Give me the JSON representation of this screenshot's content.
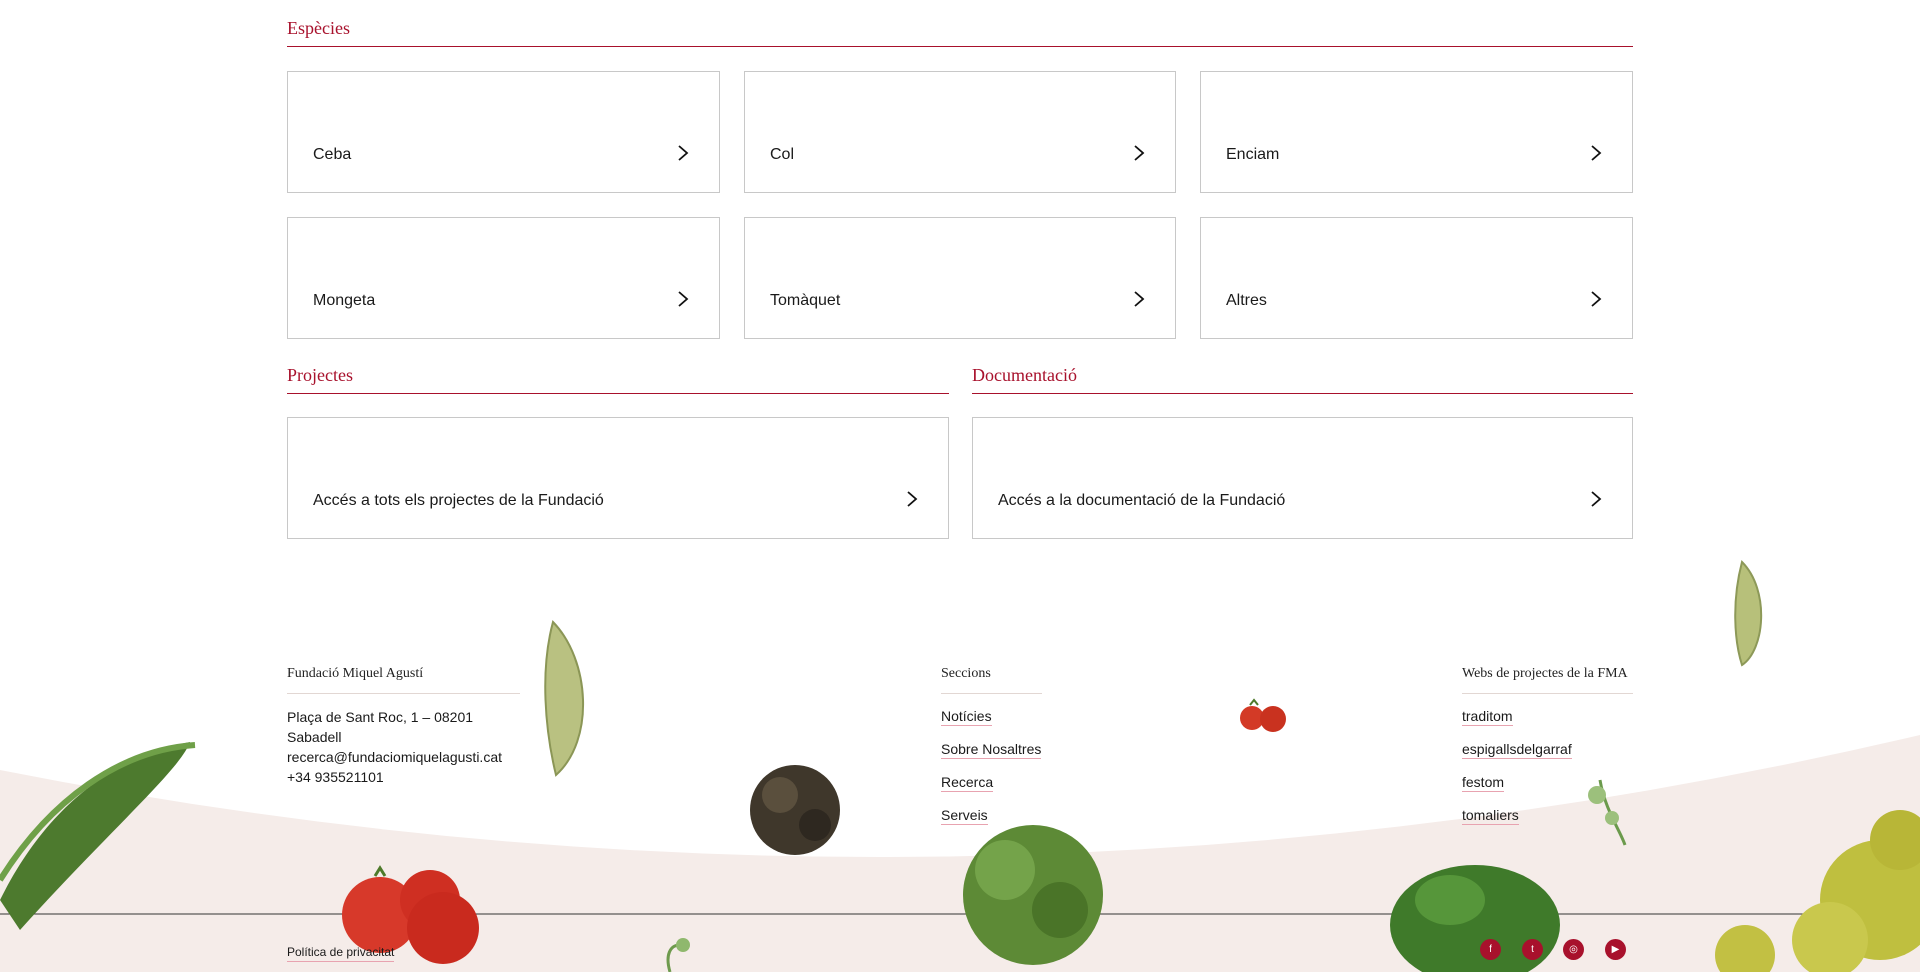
{
  "species": {
    "title": "Espècies",
    "items": [
      {
        "label": "Ceba"
      },
      {
        "label": "Col"
      },
      {
        "label": "Enciam"
      },
      {
        "label": "Mongeta"
      },
      {
        "label": "Tomàquet"
      },
      {
        "label": "Altres"
      }
    ]
  },
  "projects": {
    "title": "Projectes",
    "card_label": "Accés a tots els projectes de la Fundació"
  },
  "documentation": {
    "title": "Documentació",
    "card_label": "Accés a la documentació de la Fundació"
  },
  "footer": {
    "org": {
      "title": "Fundació Miquel Agustí",
      "address": "Plaça de Sant Roc, 1 – 08201 Sabadell",
      "email": "recerca@fundaciomiquelagusti.cat",
      "phone": "+34 935521101"
    },
    "sections": {
      "title": "Seccions",
      "links": [
        "Notícies",
        "Sobre Nosaltres",
        "Recerca",
        "Serveis"
      ]
    },
    "projects_webs": {
      "title": "Webs de projectes de la FMA",
      "links": [
        "traditom",
        "espigallsdelgarraf",
        "festom",
        "tomaliers"
      ]
    },
    "privacy": "Política de privacitat",
    "social": [
      {
        "icon": "facebook-icon",
        "glyph": "f"
      },
      {
        "icon": "twitter-icon",
        "glyph": "t"
      },
      {
        "icon": "instagram-icon",
        "glyph": "◎"
      },
      {
        "icon": "youtube-icon",
        "glyph": "▶"
      }
    ]
  },
  "colors": {
    "accent": "#a8112c",
    "footer_bg": "#f5ece9",
    "card_border": "#c8c8c8"
  }
}
